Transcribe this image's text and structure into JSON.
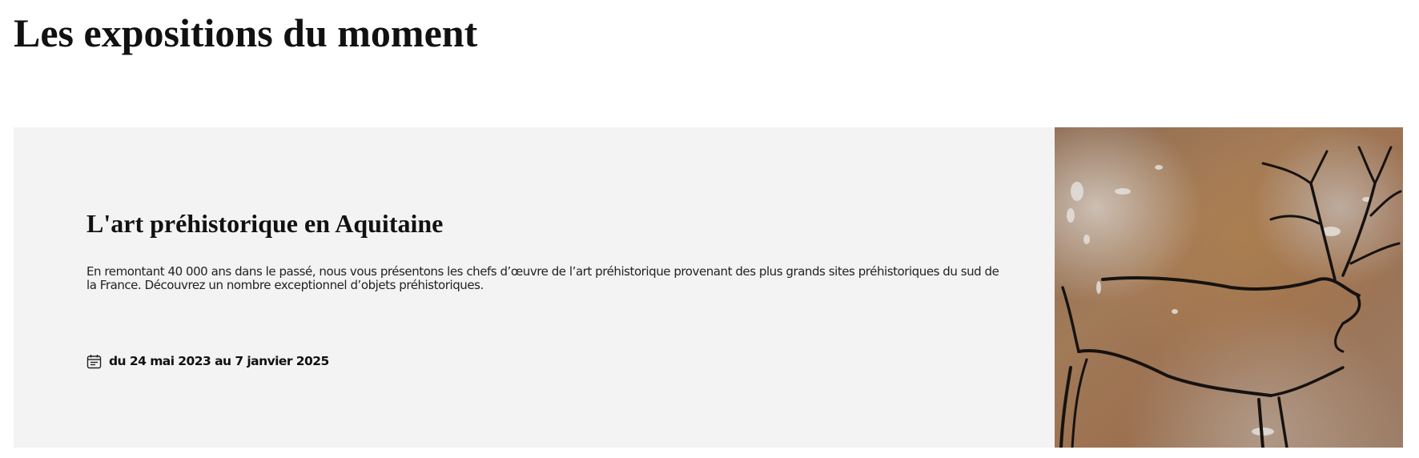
{
  "page": {
    "heading": "Les expositions du moment"
  },
  "exhibition": {
    "title": "L'art préhistorique en Aquitaine",
    "description": "En remontant 40 000 ans dans le passé, nous vous présentons les chefs d’œuvre de l’art préhistorique provenant des plus grands sites préhistoriques du sud de la France. Découvrez un nombre exceptionnel d’objets préhistoriques.",
    "dates": "du 24 mai 2023 au 7 janvier 2025",
    "date_icon": "calendar-icon",
    "image_subject": "cave painting of a deer"
  },
  "colors": {
    "card_background": "#f3f3f3",
    "text": "#111111",
    "rock_base": "#9a7356"
  }
}
